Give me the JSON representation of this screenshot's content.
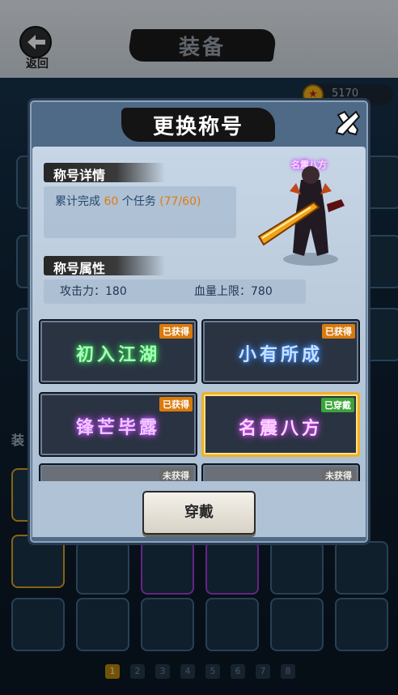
{
  "background": {
    "back_label": "返回",
    "page_title": "装备",
    "gold_amount": "5170",
    "side_label": "装",
    "pages": [
      "1",
      "2",
      "3",
      "4",
      "5",
      "6",
      "7",
      "8"
    ],
    "active_page": "1"
  },
  "modal": {
    "title": "更换称号",
    "close_icon": "close-x-icon",
    "detail_section": {
      "header": "称号详情",
      "text_prefix": "累计完成 ",
      "task_count": "60",
      "text_middle": " 个任务 ",
      "progress": "(77/60)"
    },
    "attr_section": {
      "header": "称号属性",
      "attack": "攻击力：180",
      "hp": "血量上限：780"
    },
    "hero_title": "名震八方",
    "titles": [
      {
        "name": "初入江湖",
        "status": "已获得",
        "state": "got",
        "color": "#36d957"
      },
      {
        "name": "小有所成",
        "status": "已获得",
        "state": "got",
        "color": "#3b8cff"
      },
      {
        "name": "锋芒毕露",
        "status": "已获得",
        "state": "got",
        "color": "#c24bff"
      },
      {
        "name": "名震八方",
        "status": "已穿戴",
        "state": "wear",
        "color": "#d94bff"
      },
      {
        "name": "",
        "status": "未获得",
        "state": "not",
        "color": "#888888"
      },
      {
        "name": "",
        "status": "未获得",
        "state": "not",
        "color": "#888888"
      }
    ],
    "wear_button": "穿戴"
  },
  "colors": {
    "accent_orange": "#e07a12",
    "selected_border": "#f0b127",
    "modal_bg": "#4f6a86"
  }
}
